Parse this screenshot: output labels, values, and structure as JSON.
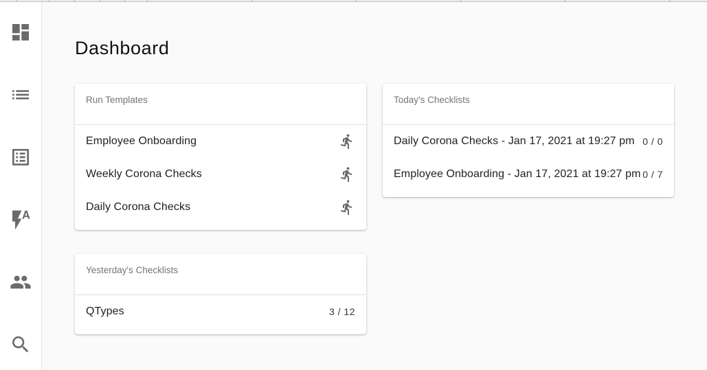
{
  "sidebar": {
    "items": [
      {
        "name": "dashboard",
        "icon": "dashboard-icon"
      },
      {
        "name": "list",
        "icon": "list-icon"
      },
      {
        "name": "checklists",
        "icon": "list-alt-icon"
      },
      {
        "name": "automation",
        "icon": "flash-auto-icon"
      },
      {
        "name": "users",
        "icon": "people-icon"
      },
      {
        "name": "search",
        "icon": "search-icon"
      }
    ]
  },
  "page": {
    "title": "Dashboard"
  },
  "run_templates": {
    "title": "Run Templates",
    "items": [
      {
        "label": "Employee Onboarding",
        "icon": "run-icon"
      },
      {
        "label": "Weekly Corona Checks",
        "icon": "run-icon"
      },
      {
        "label": "Daily Corona Checks",
        "icon": "run-icon"
      }
    ]
  },
  "todays_checklists": {
    "title": "Today's Checklists",
    "items": [
      {
        "label": "Daily Corona Checks - Jan 17, 2021 at 19:27 pm",
        "count": "0 / 0"
      },
      {
        "label": "Employee Onboarding - Jan 17, 2021 at 19:27 pm",
        "count": "0 / 7"
      }
    ]
  },
  "yesterdays_checklists": {
    "title": "Yesterday's Checklists",
    "items": [
      {
        "label": "QTypes",
        "count": "3 / 12"
      }
    ]
  }
}
